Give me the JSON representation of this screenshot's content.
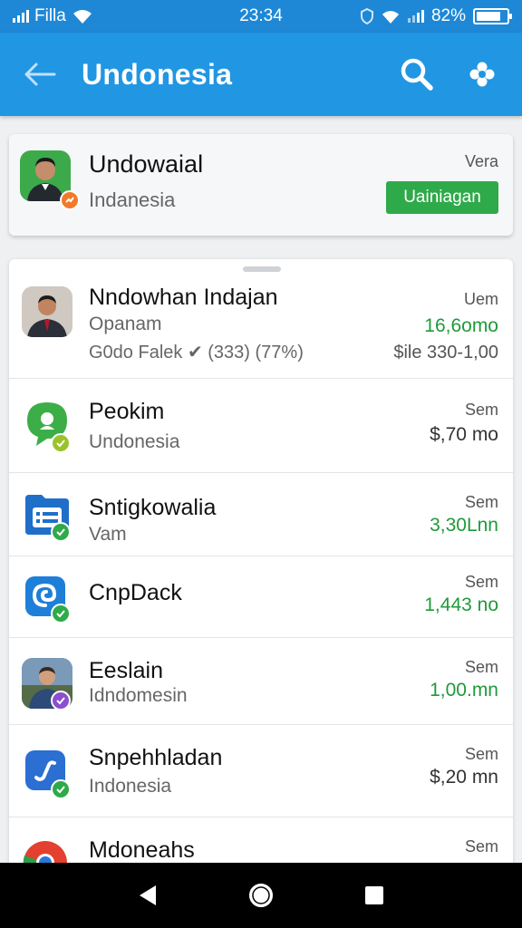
{
  "status_bar": {
    "carrier": "Filla",
    "time": "23:34",
    "battery": "82%",
    "battery_level": 0.82
  },
  "app_bar": {
    "title": "Undonesia"
  },
  "profile": {
    "name": "Undowaial",
    "subtitle": "Indanesia",
    "meta": "Vera",
    "button_label": "Uainiagan"
  },
  "list": {
    "items": [
      {
        "name": "Nndowhan Indajan",
        "subtitle": "Opanam",
        "detail": "G0do Falek ✔ (333) (77%)",
        "right_top": "Uem",
        "right_value": "16,6omo",
        "right_detail": "$ile 330-1,00",
        "value_color": "green"
      },
      {
        "name": "Peokim",
        "subtitle": "Undonesia",
        "right_top": "Sem",
        "right_value": "$,70 mo",
        "value_color": "dark"
      },
      {
        "name": "Sntigkowalia",
        "subtitle": "Vam",
        "right_top": "Sem",
        "right_value": "3,30Lnn",
        "value_color": "green"
      },
      {
        "name": "CnpDack",
        "subtitle": "",
        "right_top": "Sem",
        "right_value": "1,443 no",
        "value_color": "green"
      },
      {
        "name": "Eeslain",
        "subtitle": "Idndomesin",
        "right_top": "Sem",
        "right_value": "1,00.mn",
        "value_color": "green"
      },
      {
        "name": "Snpehhladan",
        "subtitle": "Indonesia",
        "right_top": "Sem",
        "right_value": "$,20 mn",
        "value_color": "dark"
      },
      {
        "name": "Mdoneahs",
        "subtitle": "",
        "right_top": "Sem",
        "right_value": "",
        "value_color": "green"
      }
    ]
  },
  "colors": {
    "app_bar": "#2196e3",
    "status_bar": "#1e88d6",
    "accent_green": "#2faa4a",
    "value_green": "#1f9a3a"
  },
  "icons": {
    "back": "arrow-left-icon",
    "search": "search-icon",
    "settings": "flower-settings-icon",
    "nav_back": "triangle-back-icon",
    "nav_home": "circle-home-icon",
    "nav_recents": "square-recents-icon"
  }
}
